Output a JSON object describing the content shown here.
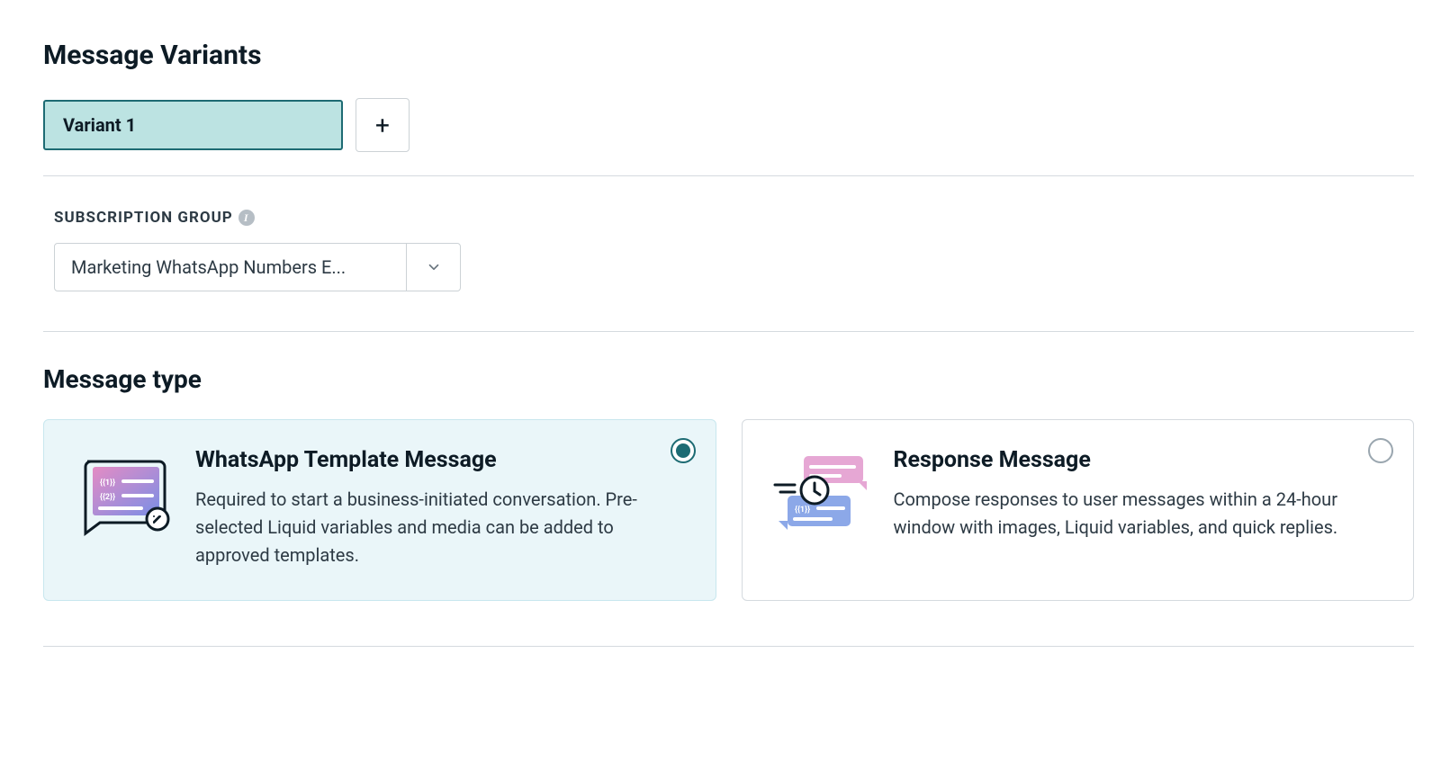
{
  "header": {
    "title": "Message Variants"
  },
  "variants": {
    "tabs": [
      {
        "label": "Variant 1"
      }
    ],
    "add_icon_char": "+"
  },
  "subscription": {
    "label": "SUBSCRIPTION GROUP",
    "info_char": "i",
    "selected": "Marketing WhatsApp Numbers E..."
  },
  "message_type": {
    "title": "Message type",
    "options": [
      {
        "id": "template-message",
        "title": "WhatsApp Template Message",
        "desc": "Required to start a business-initiated conversation. Pre-selected Liquid variables and media can be added to approved templates.",
        "selected": true
      },
      {
        "id": "response-message",
        "title": "Response Message",
        "desc": "Compose responses to user messages within a 24-hour window with images, Liquid variables, and quick replies.",
        "selected": false
      }
    ]
  }
}
